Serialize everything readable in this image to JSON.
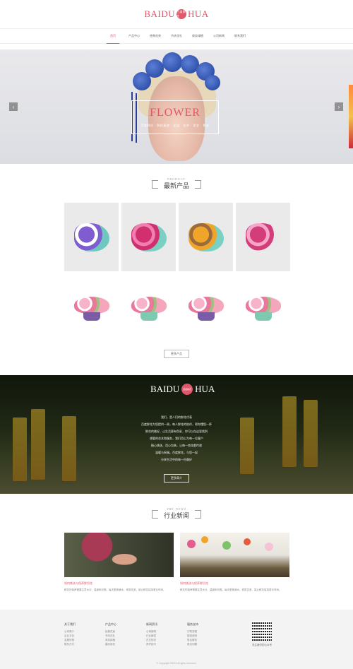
{
  "header": {
    "logo_left": "BAIDU",
    "logo_badge": "百度鲜花",
    "logo_right": "HUA"
  },
  "nav": [
    {
      "label": "首页",
      "active": true
    },
    {
      "label": "产品中心"
    },
    {
      "label": "经典花束"
    },
    {
      "label": "节庆花礼"
    },
    {
      "label": "商务绿植"
    },
    {
      "label": "公司新闻"
    },
    {
      "label": "联系我们"
    }
  ],
  "banner": {
    "title": "FLOWER",
    "subtitle": "百度鲜花 · 鲜花速递 · 花店 · 花卉 · 花艺 · 鲜花"
  },
  "products_section": {
    "en": "PRODUCT",
    "cn": "最新产品",
    "more": "更多产品"
  },
  "products": [
    {
      "style": "bouquet",
      "colors": "#7f5cd0,#fff,#6ec8c0"
    },
    {
      "style": "bouquet",
      "colors": "#d12f6e,#ef7fb0,#7ad0c2"
    },
    {
      "style": "bouquet",
      "colors": "#f0a52a,#9a6b3c,#7ad0c2"
    },
    {
      "style": "bouquet",
      "colors": "#d33d7a,#f6a6c8,#e9e9e9"
    },
    {
      "style": "basket",
      "pot": "#7a5ca6"
    },
    {
      "style": "basket",
      "pot": "#7ec9b2"
    },
    {
      "style": "basket",
      "pot": "#7a5ca6"
    },
    {
      "style": "basket",
      "pot": "#7ec9b2"
    }
  ],
  "about": {
    "logo_left": "BAIDU",
    "logo_badge": "百度鲜花",
    "logo_right": "HUA",
    "lines": [
      "我们，是人们的鲜花代表",
      "百度鲜花为您提供一周，每人鲜花的陪伴，帮你懂您一杯",
      "鲜花的美好。让生活更有色彩，你可以在这里找到",
      "想要的花艺和服务，我们用心为每一位客户",
      "精心挑选、用心包装，让每一束花都传递",
      "温暖与祝福。百度鲜花，与您一起",
      "分享生活中的每一份美好"
    ],
    "more": "更多简介"
  },
  "news_section": {
    "en": "THE NEWS",
    "cn": "行业新闻"
  },
  "news": [
    {
      "title": "如何挑选与保养鲜切花",
      "desc": "鲜花的保养需要注意水分、温度和光照。每天更换清水，修剪花茎，能让鲜花保持更长时间。"
    },
    {
      "title": "如何挑选与保养鲜切花",
      "desc": "鲜花的保养需要注意水分、温度和光照。每天更换清水，修剪花茎，能让鲜花保持更长时间。"
    }
  ],
  "footer": {
    "columns": [
      {
        "title": "关于我们",
        "items": [
          "公司简介",
          "企业文化",
          "发展历程",
          "联系方式"
        ]
      },
      {
        "title": "产品中心",
        "items": [
          "经典花束",
          "节庆花礼",
          "商务绿植",
          "婚庆用花"
        ]
      },
      {
        "title": "新闻资讯",
        "items": [
          "公司新闻",
          "行业新闻",
          "花艺知识",
          "养护技巧"
        ]
      },
      {
        "title": "服务支持",
        "items": [
          "订购流程",
          "配送说明",
          "售后服务",
          "常见问题"
        ]
      }
    ],
    "qr_label": "关注我们的公众号",
    "copyright": "© Copyright 2019 All rights reserved."
  }
}
